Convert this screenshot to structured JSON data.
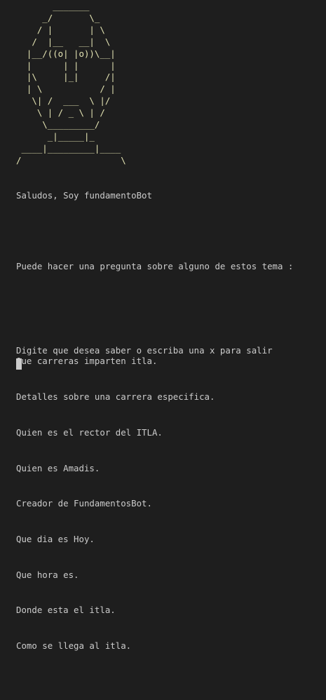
{
  "ascii_art": [
    "       _______",
    "     _/       \\_",
    "    / |       | \\",
    "   /  |__   __|  \\",
    "  |__/((o| |o))\\__|",
    "  |      | |      |",
    "  |\\     |_|     /|",
    "  | \\           / |",
    "   \\| /  ___  \\ |/",
    "    \\ | / _ \\ | /",
    "     \\_________/",
    "      _|_____|_",
    " ____|_________|____",
    "/                   \\"
  ],
  "greeting": "Saludos, Soy fundamentoBot",
  "question_prompt": "Puede hacer una pregunta sobre alguno de estos tema :",
  "topics": [
    "Que carreras imparten itla.",
    "Detalles sobre una carrera especifica.",
    "Quien es el rector del ITLA.",
    "Quien es Amadis.",
    "Creador de FundamentosBot.",
    "Que dia es Hoy.",
    "Que hora es.",
    "Donde esta el itla.",
    "Como se llega al itla."
  ],
  "input_prompt": "Digite que desea saber o escriba una x para salir",
  "colors": {
    "background": "#1e1e1e",
    "text": "#cccccc",
    "ascii_art": "#e5e5b4"
  }
}
